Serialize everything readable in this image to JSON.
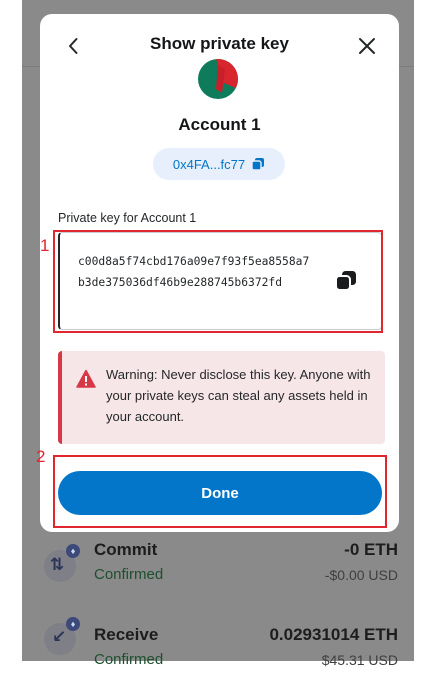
{
  "modal": {
    "title": "Show private key",
    "account_name": "Account 1",
    "address": "0x4FA...fc77",
    "private_key_label": "Private key for Account 1",
    "private_key": "c00d8a5f74cbd176a09e7f93f5ea8558a7b3de375036df46b9e288745b6372fd",
    "warning": "Warning: Never disclose this key. Anyone with your private keys can steal any assets held in your account.",
    "done_label": "Done"
  },
  "background": {
    "transactions": [
      {
        "title": "Commit",
        "status": "Confirmed",
        "amount": "-0 ETH",
        "fiat": "-$0.00 USD"
      },
      {
        "title": "Receive",
        "status": "Confirmed",
        "amount": "0.02931014 ETH",
        "fiat": "$45.31 USD"
      }
    ]
  },
  "annotations": [
    "1",
    "2"
  ],
  "colors": {
    "accent": "#0376c9",
    "error": "#d73847",
    "annotation": "#e0262f"
  }
}
